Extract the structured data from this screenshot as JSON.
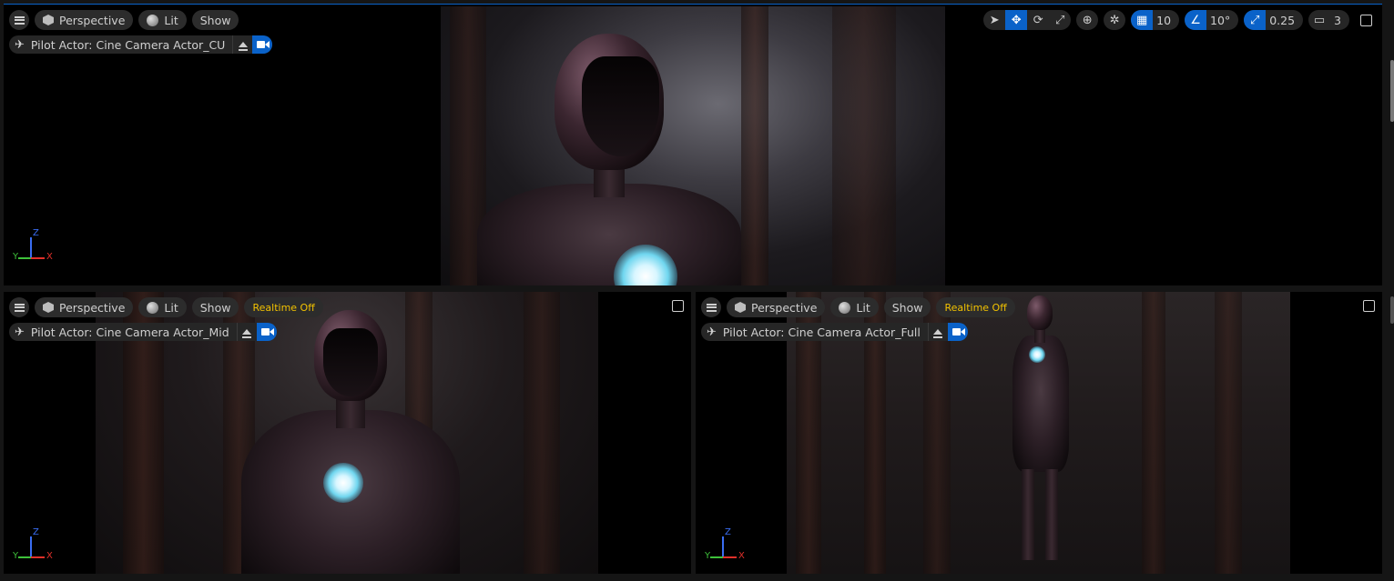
{
  "viewports": [
    {
      "id": "top",
      "view_mode": "Perspective",
      "lighting": "Lit",
      "show_label": "Show",
      "realtime": "",
      "pilot_label": "Pilot Actor: Cine Camera Actor_CU"
    },
    {
      "id": "bottom-left",
      "view_mode": "Perspective",
      "lighting": "Lit",
      "show_label": "Show",
      "realtime": "Realtime Off",
      "pilot_label": "Pilot Actor: Cine Camera Actor_Mid"
    },
    {
      "id": "bottom-right",
      "view_mode": "Perspective",
      "lighting": "Lit",
      "show_label": "Show",
      "realtime": "Realtime Off",
      "pilot_label": "Pilot Actor: Cine Camera Actor_Full"
    }
  ],
  "transform_tools": {
    "grid_snap_value": "10",
    "rotation_snap_value": "10°",
    "scale_snap_value": "0.25",
    "camera_speed_value": "3"
  },
  "gizmo": {
    "x": "X",
    "y": "Y",
    "z": "Z"
  },
  "colors": {
    "accent": "#0a62c9",
    "realtime_warning": "#f2c200",
    "axis_x": "#e0302a",
    "axis_y": "#3ec13a",
    "axis_z": "#3a6df2"
  }
}
